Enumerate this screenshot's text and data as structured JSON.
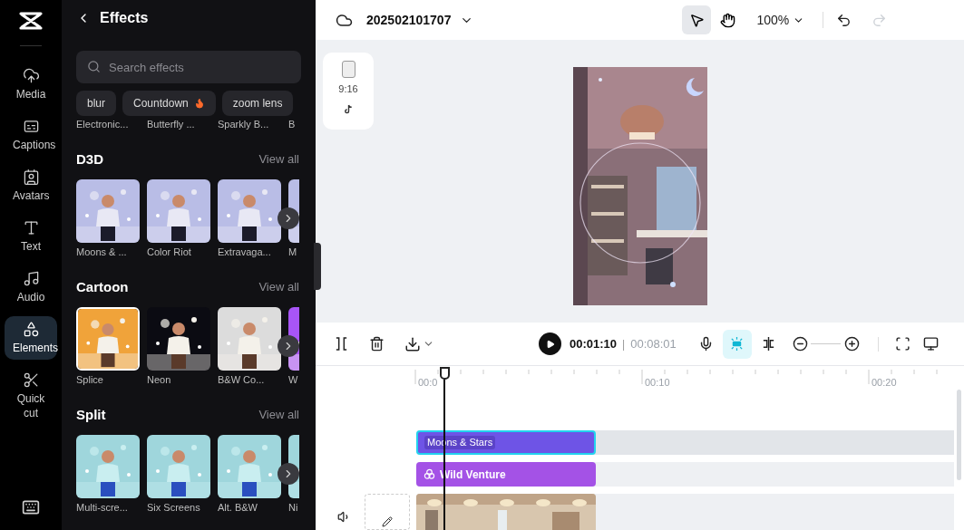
{
  "nav": {
    "items": [
      {
        "label": "Media",
        "selected": false
      },
      {
        "label": "Captions",
        "selected": false
      },
      {
        "label": "Avatars",
        "selected": false
      },
      {
        "label": "Text",
        "selected": false
      },
      {
        "label": "Audio",
        "selected": false
      },
      {
        "label": "Elements",
        "selected": true
      },
      {
        "label": "Quick cut",
        "selected": false
      }
    ]
  },
  "panel": {
    "title": "Effects",
    "search": {
      "placeholder": "Search effects"
    },
    "chips": [
      {
        "label": "blur",
        "hot": false
      },
      {
        "label": "Countdown",
        "hot": true
      },
      {
        "label": "zoom lens",
        "hot": false
      }
    ],
    "scrolled_labels": [
      "Electronic...",
      "Butterfly ...",
      "Sparkly B...",
      "B"
    ],
    "sections": [
      {
        "title": "D3D",
        "link": "View all",
        "items": [
          {
            "label": "Moons & ...",
            "kind": "picture"
          },
          {
            "label": "Color Riot",
            "kind": "picture"
          },
          {
            "label": "Extravaga...",
            "kind": "picture"
          },
          {
            "label": "M",
            "kind": "picture"
          }
        ]
      },
      {
        "title": "Cartoon",
        "link": "View all",
        "items": [
          {
            "label": "Splice",
            "kind": "picture"
          },
          {
            "label": "Neon",
            "kind": "picture"
          },
          {
            "label": "B&W Co...",
            "kind": "picture"
          },
          {
            "label": "W",
            "kind": "picture"
          }
        ]
      },
      {
        "title": "Split",
        "link": "View all",
        "items": [
          {
            "label": "Multi-scre...",
            "kind": "picture"
          },
          {
            "label": "Six Screens",
            "kind": "picture"
          },
          {
            "label": "Alt. B&W",
            "kind": "picture"
          },
          {
            "label": "Ni",
            "kind": "picture"
          }
        ]
      }
    ]
  },
  "topbar": {
    "project": "202502101707",
    "zoom": "100%",
    "select_tool": {
      "selected": true
    },
    "hand_tool": {
      "selected": false
    }
  },
  "canvas": {
    "ratio": "9:16"
  },
  "timeline": {
    "current": "00:01:10",
    "separator": "|",
    "total": "00:08:01",
    "snap": {
      "on": true
    },
    "ruler": [
      "00:0",
      "00:10",
      "00:20"
    ],
    "tracks": [
      {
        "kind": "effect",
        "label": "Moons & Stars",
        "selected": true
      },
      {
        "kind": "filter",
        "label": "Wild Venture",
        "selected": false
      },
      {
        "kind": "video",
        "selected": false
      }
    ]
  }
}
